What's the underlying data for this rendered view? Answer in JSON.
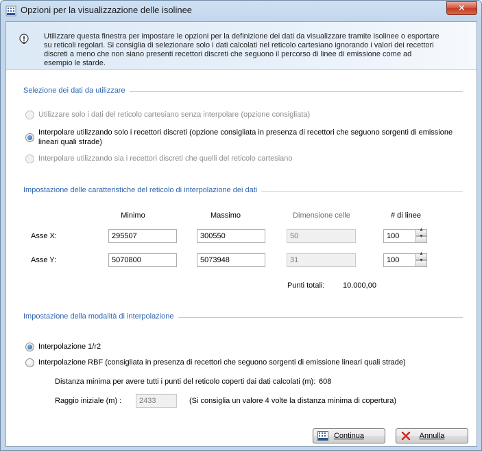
{
  "window": {
    "title": "Opzioni per la visualizzazione delle isolinee",
    "close_glyph": "✕",
    "icon": "grid-app-icon"
  },
  "info": {
    "icon": "info-bulb-icon",
    "text": "Utilizzare questa finestra per impostare le opzioni per la definizione dei dati da visualizzare tramite isolinee o esportare su reticoli regolari. Si consiglia di selezionare solo i dati calcolati nel reticolo cartesiano ignorando i valori dei recettori discreti a meno che non siano presenti recettori discreti che seguono il percorso di linee di emissione come ad esempio le starde."
  },
  "data_selection": {
    "title": "Selezione dei dati da utilizzare",
    "options": [
      {
        "label": "Utilizzare solo i dati del reticolo cartesiano senza interpolare (opzione consigliata)",
        "checked": false,
        "enabled": false
      },
      {
        "label": "Interpolare utilizzando solo i recettori discreti (opzione consigliata in presenza di recettori che seguono sorgenti di emissione lineari quali strade)",
        "checked": true,
        "enabled": true
      },
      {
        "label": "Interpolare utilizzando sia i recettori discreti che quelli del reticolo cartesiano",
        "checked": false,
        "enabled": false
      }
    ]
  },
  "grid": {
    "title": "Impostazione delle caratteristiche del reticolo di interpolazione dei dati",
    "headers": {
      "min": "Minimo",
      "max": "Massimo",
      "cell": "Dimensione celle",
      "lines": "# di linee"
    },
    "rows": [
      {
        "label": "Asse X:",
        "min": "295507",
        "max": "300550",
        "cell": "50",
        "lines": "100"
      },
      {
        "label": "Asse Y:",
        "min": "5070800",
        "max": "5073948",
        "cell": "31",
        "lines": "100"
      }
    ],
    "total_label": "Punti totali:",
    "total_value": "10.000,00"
  },
  "interp": {
    "title": "Impostazione della modalità di interpolazione",
    "options": [
      {
        "label": "Interpolazione 1/r2",
        "checked": true
      },
      {
        "label": "Interpolazione RBF (consigliata in presenza di recettori che seguono sorgenti di emissione lineari quali strade)",
        "checked": false
      }
    ],
    "min_distance_label": "Distanza minima per avere tutti i punti del reticolo coperti dai dati calcolati (m):",
    "min_distance_value": "608",
    "radius_label": "Raggio iniziale (m) :",
    "radius_value": "2433",
    "radius_hint": "(Si consiglia un valore 4 volte la distanza minima di copertura)"
  },
  "buttons": {
    "continue_label": "Continua",
    "continue_icon": "grid-continue-icon",
    "cancel_label": "Annulla",
    "cancel_icon": "red-x-icon"
  },
  "colors": {
    "group_title": "#2e64b0",
    "titlebar": "#c2d6ec",
    "close": "#c33b22"
  }
}
